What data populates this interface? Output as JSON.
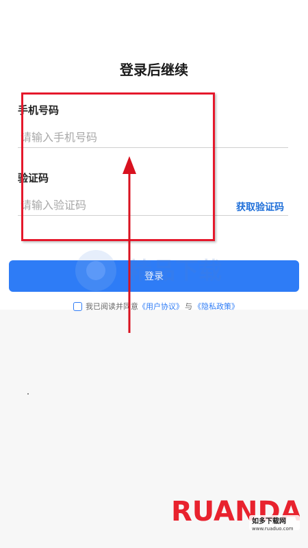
{
  "page": {
    "title": "登录后继续"
  },
  "form": {
    "phone": {
      "label": "手机号码",
      "placeholder": "请输入手机号码",
      "value": ""
    },
    "code": {
      "label": "验证码",
      "placeholder": "请输入验证码",
      "value": "",
      "get_code_label": "获取验证码"
    },
    "login_label": "登录"
  },
  "agreement": {
    "checked": false,
    "prefix": "我已阅读并同意",
    "user_agreement": "《用户协议》",
    "conjunction": "与",
    "privacy_policy": "《隐私政策》"
  },
  "colors": {
    "accent": "#2e7cf6",
    "link": "#1f6fd9",
    "annotation": "#e5182b"
  },
  "watermarks": {
    "center_text": "精品下载",
    "brand_text": "RUANDAO",
    "brand_cn": "如多下载网",
    "brand_url": "www.ruaduo.com"
  }
}
